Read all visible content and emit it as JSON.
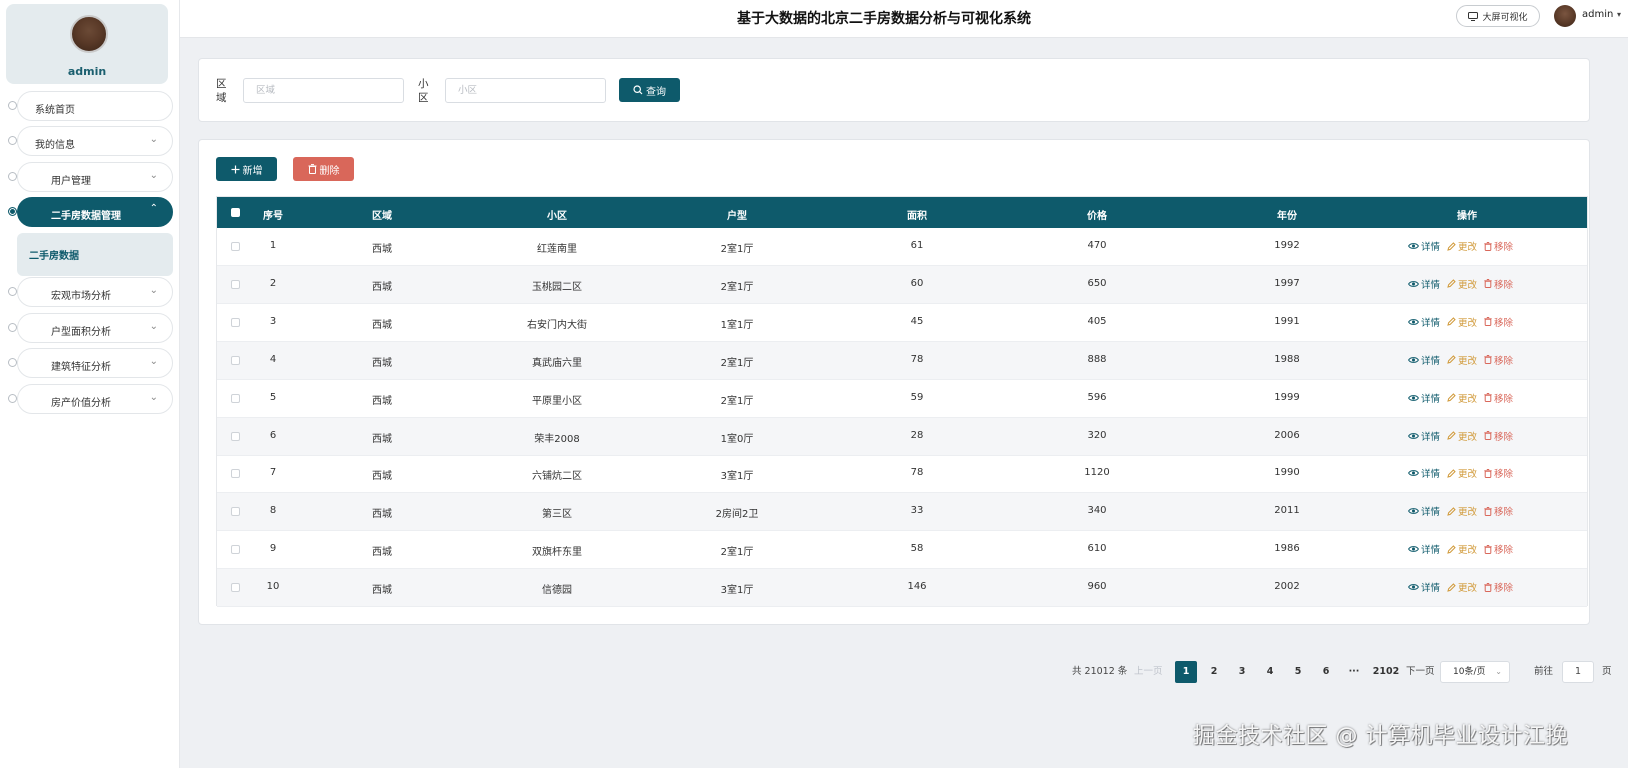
{
  "sidebar": {
    "profile_name": "admin",
    "items": [
      {
        "label": "系统首页",
        "has_chevron": false
      },
      {
        "label": "我的信息",
        "has_chevron": true
      },
      {
        "label": "用户管理",
        "has_chevron": true
      },
      {
        "label": "二手房数据管理",
        "has_chevron": true,
        "active": true
      },
      {
        "label": "宏观市场分析",
        "has_chevron": true
      },
      {
        "label": "户型面积分析",
        "has_chevron": true
      },
      {
        "label": "建筑特征分析",
        "has_chevron": true
      },
      {
        "label": "房产价值分析",
        "has_chevron": true
      }
    ],
    "submenu_active": "二手房数据"
  },
  "header": {
    "title": "基于大数据的北京二手房数据分析与可视化系统",
    "bigscreen_label": "大屏可视化",
    "username": "admin"
  },
  "search": {
    "district_label": "区域",
    "district_placeholder": "区域",
    "community_label": "小区",
    "community_placeholder": "小区",
    "query_label": "查询"
  },
  "toolbar": {
    "add_label": "新增",
    "delete_label": "删除"
  },
  "table": {
    "columns": [
      "序号",
      "区域",
      "小区",
      "户型",
      "面积",
      "价格",
      "年份",
      "操作"
    ],
    "rows": [
      [
        "1",
        "西城",
        "红莲南里",
        "2室1厅",
        "61",
        "470",
        "1992"
      ],
      [
        "2",
        "西城",
        "玉桃园二区",
        "2室1厅",
        "60",
        "650",
        "1997"
      ],
      [
        "3",
        "西城",
        "右安门内大街",
        "1室1厅",
        "45",
        "405",
        "1991"
      ],
      [
        "4",
        "西城",
        "真武庙六里",
        "2室1厅",
        "78",
        "888",
        "1988"
      ],
      [
        "5",
        "西城",
        "平原里小区",
        "2室1厅",
        "59",
        "596",
        "1999"
      ],
      [
        "6",
        "西城",
        "荣丰2008",
        "1室0厅",
        "28",
        "320",
        "2006"
      ],
      [
        "7",
        "西城",
        "六铺炕二区",
        "3室1厅",
        "78",
        "1120",
        "1990"
      ],
      [
        "8",
        "西城",
        "第三区",
        "2房间2卫",
        "33",
        "340",
        "2011"
      ],
      [
        "9",
        "西城",
        "双旗杆东里",
        "2室1厅",
        "58",
        "610",
        "1986"
      ],
      [
        "10",
        "西城",
        "信德园",
        "3室1厅",
        "146",
        "960",
        "2002"
      ]
    ],
    "actions": {
      "detail": "详情",
      "edit": "更改",
      "remove": "移除"
    }
  },
  "pagination": {
    "total_text": "共 21012 条",
    "prev_label": "上一页",
    "pages": [
      "1",
      "2",
      "3",
      "4",
      "5",
      "6"
    ],
    "ellipsis": "···",
    "last_page": "2102",
    "next_label": "下一页",
    "page_size_label": "10条/页",
    "goto_label": "前往",
    "goto_value": "1",
    "page_suffix": "页",
    "current_page": 1
  },
  "watermark": "掘金技术社区 @ 计算机毕业设计江挽",
  "colors": {
    "primary": "#0e5a6b",
    "danger": "#d9675a",
    "warning": "#d19a3a"
  }
}
